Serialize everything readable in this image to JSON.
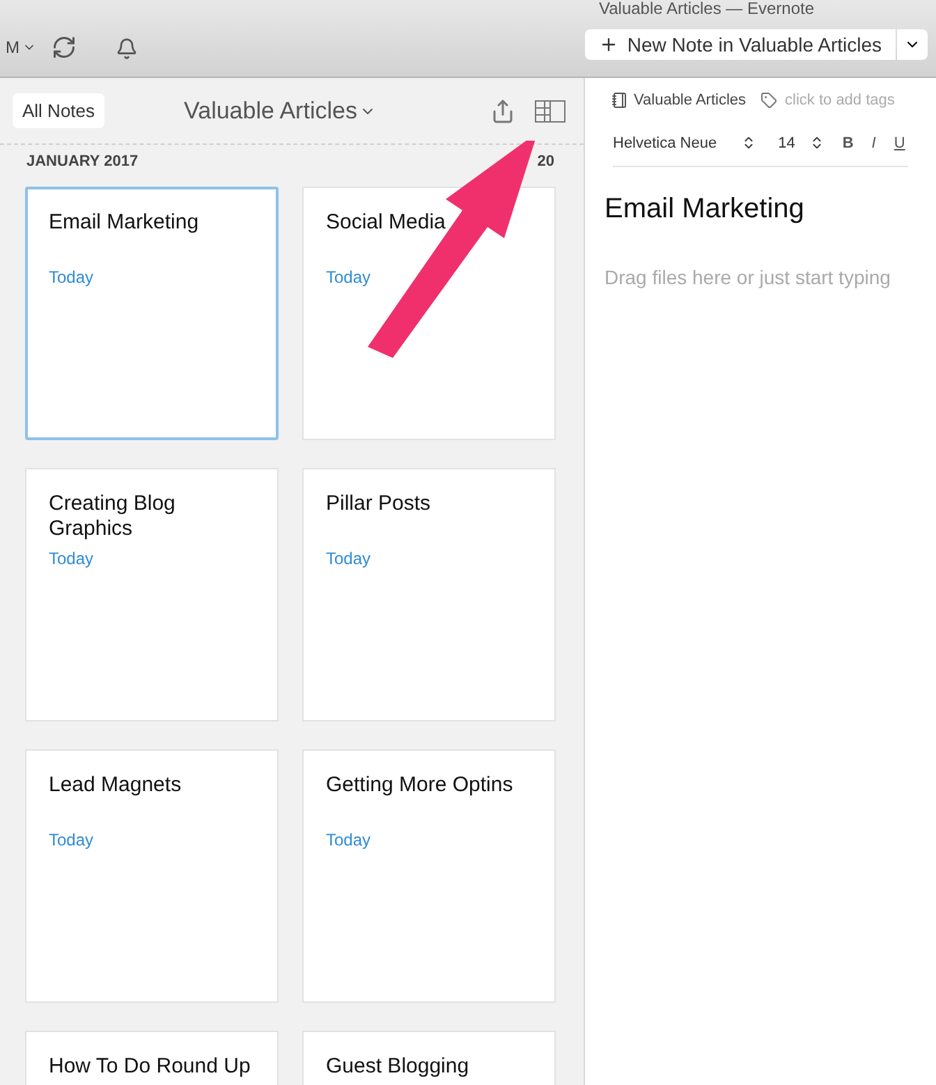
{
  "window": {
    "title": "Valuable Articles — Evernote"
  },
  "toolbar": {
    "account": "M",
    "new_note_button": "New Note in Valuable Articles"
  },
  "notes_list": {
    "all_notes_button": "All Notes",
    "notebook_title": "Valuable Articles",
    "month": "JANUARY 2017",
    "count": "20",
    "notes": [
      {
        "title": "Email Marketing",
        "date": "Today",
        "selected": true
      },
      {
        "title": "Social Media",
        "date": "Today",
        "selected": false
      },
      {
        "title": "Creating Blog Graphics",
        "date": "Today",
        "selected": false
      },
      {
        "title": "Pillar Posts",
        "date": "Today",
        "selected": false
      },
      {
        "title": "Lead Magnets",
        "date": "Today",
        "selected": false
      },
      {
        "title": "Getting More Optins",
        "date": "Today",
        "selected": false
      },
      {
        "title": "How To Do Round Up",
        "selected": false
      },
      {
        "title": "Guest Blogging",
        "selected": false
      }
    ]
  },
  "editor": {
    "notebook": "Valuable Articles",
    "tags_placeholder": "click to add tags",
    "font": "Helvetica Neue",
    "size": "14",
    "format_buttons": [
      "B",
      "I",
      "U"
    ],
    "note_title": "Email Marketing",
    "body_placeholder": "Drag files here or just start typing"
  }
}
